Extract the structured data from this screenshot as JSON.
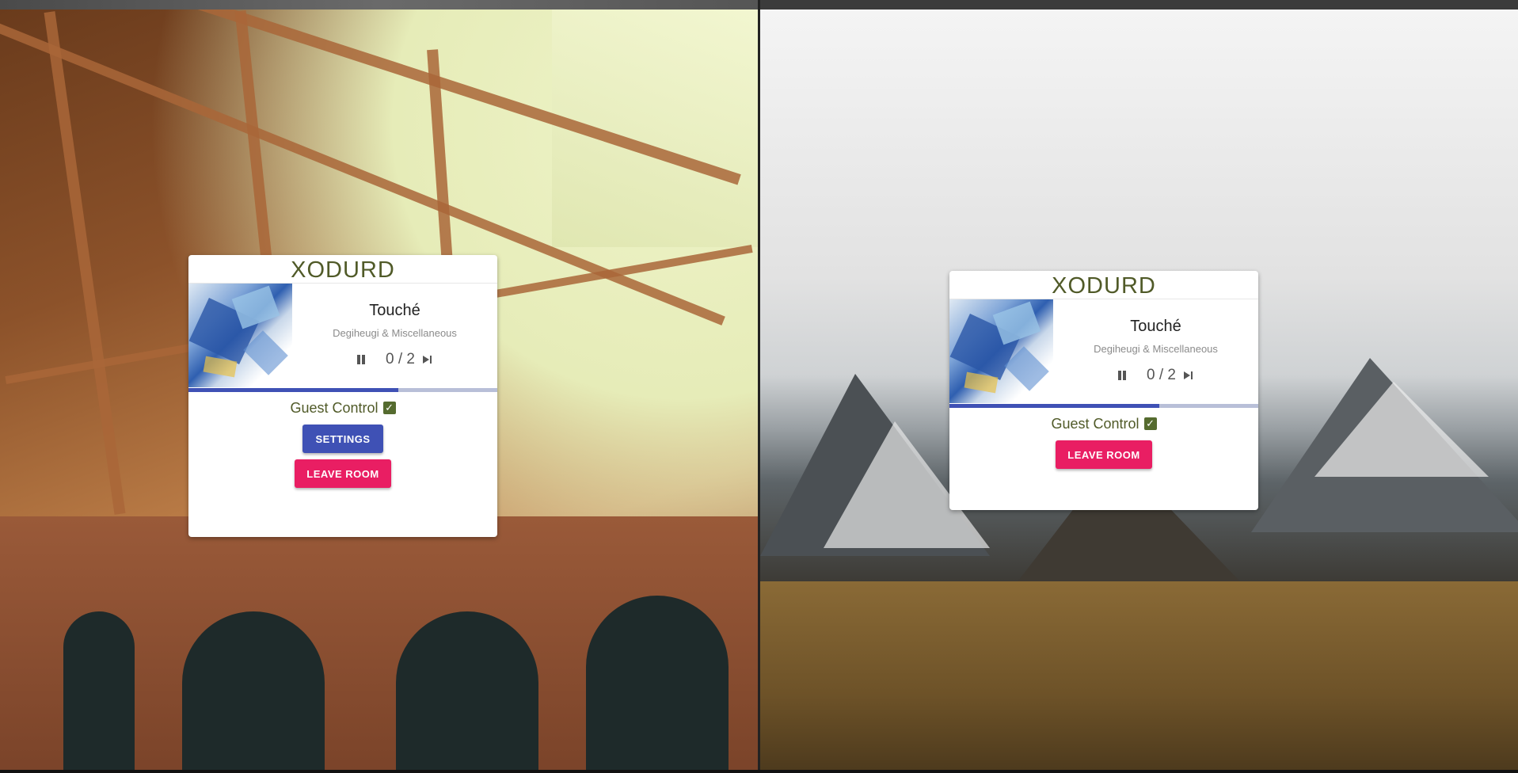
{
  "room": {
    "code": "XODURD",
    "song_title": "Touché",
    "song_artist": "Degiheugi & Miscellaneous",
    "votes": "0 / 2",
    "progress": 0.68,
    "guest_control_label": "Guest Control",
    "guest_control_checked": true,
    "check_glyph": "✓"
  },
  "left_window": {
    "settings_label": "SETTINGS",
    "leave_label": "LEAVE ROOM"
  },
  "right_window": {
    "leave_label": "LEAVE ROOM"
  },
  "colors": {
    "title": "#505a28",
    "primary": "#3f51b5",
    "secondary": "#e91e63"
  }
}
